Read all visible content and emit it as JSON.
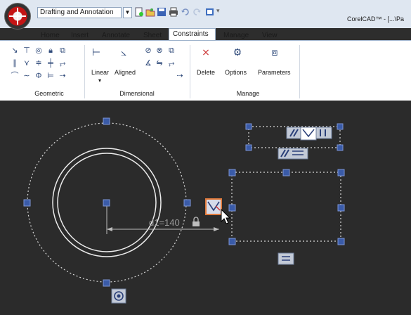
{
  "titlebar": {
    "workspace": "Drafting and Annotation",
    "window_title": "CorelCAD™ - [...\\Pa"
  },
  "tabs": [
    "Home",
    "Insert",
    "Annotate",
    "Sheet",
    "Constraints",
    "Manage",
    "View"
  ],
  "active_tab": "Constraints",
  "ribbon": {
    "groups": {
      "geometric": "Geometric",
      "dimensional": "Dimensional",
      "manage": "Manage"
    },
    "buttons": {
      "linear": "Linear",
      "aligned": "Aligned",
      "delete": "Delete",
      "options": "Options",
      "parameters": "Parameters"
    }
  },
  "canvas": {
    "dimension_label": "d1=140",
    "colors": {
      "background": "#2b2b2b",
      "geometry": "#e8e8e8",
      "grip": "#3a5ba8",
      "constraint_highlight": "#e07a3c"
    }
  }
}
